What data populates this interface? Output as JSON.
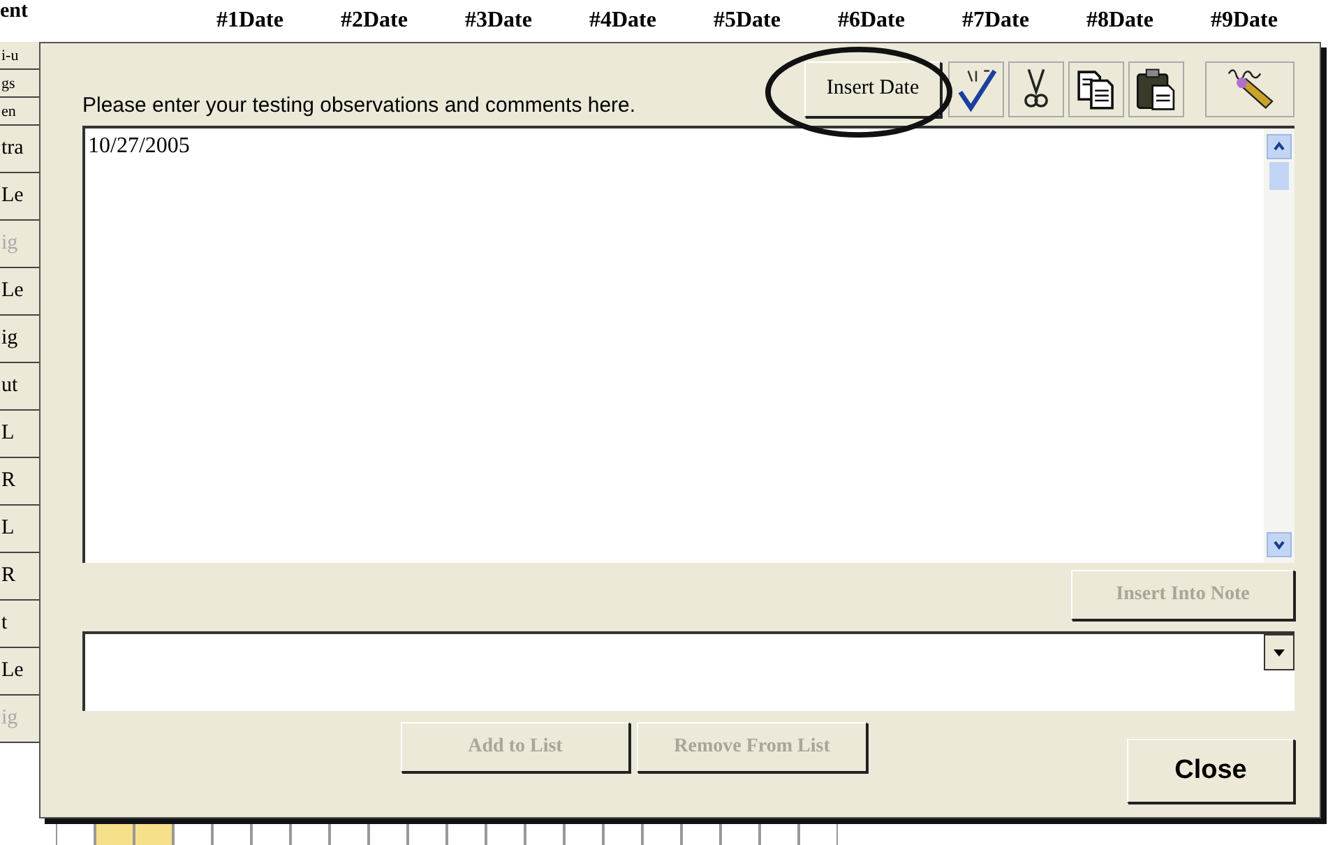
{
  "background": {
    "corner": "ent",
    "date_columns": [
      "#1Date",
      "#2Date",
      "#3Date",
      "#4Date",
      "#5Date",
      "#6Date",
      "#7Date",
      "#8Date",
      "#9Date"
    ],
    "row_labels": [
      {
        "text": "i-u",
        "disabled": false
      },
      {
        "text": "gs",
        "disabled": false
      },
      {
        "text": "en",
        "disabled": false
      },
      {
        "text": "tra",
        "disabled": false
      },
      {
        "text": "Le",
        "disabled": false
      },
      {
        "text": "ig",
        "disabled": true
      },
      {
        "text": "Le",
        "disabled": false
      },
      {
        "text": "ig",
        "disabled": false
      },
      {
        "text": "ut",
        "disabled": false
      },
      {
        "text": "L",
        "disabled": false
      },
      {
        "text": "R",
        "disabled": false
      },
      {
        "text": "L",
        "disabled": false
      },
      {
        "text": "R",
        "disabled": false
      },
      {
        "text": "t",
        "disabled": false
      },
      {
        "text": "Le",
        "disabled": false
      },
      {
        "text": "ig",
        "disabled": true
      }
    ],
    "bottom_cells": [
      {
        "highlighted": false
      },
      {
        "highlighted": true
      },
      {
        "highlighted": true
      },
      {
        "highlighted": false
      },
      {
        "highlighted": false
      },
      {
        "highlighted": false
      },
      {
        "highlighted": false
      },
      {
        "highlighted": false
      },
      {
        "highlighted": false
      },
      {
        "highlighted": false
      },
      {
        "highlighted": false
      },
      {
        "highlighted": false
      },
      {
        "highlighted": false
      },
      {
        "highlighted": false
      },
      {
        "highlighted": false
      },
      {
        "highlighted": false
      },
      {
        "highlighted": false
      },
      {
        "highlighted": false
      },
      {
        "highlighted": false
      },
      {
        "highlighted": false
      }
    ]
  },
  "dialog": {
    "prompt": "Please enter your testing observations and comments here.",
    "toolbar": [
      {
        "kind": "text",
        "label": "Insert Date",
        "circled": true
      },
      {
        "kind": "spellcheck"
      },
      {
        "kind": "cut"
      },
      {
        "kind": "copy"
      },
      {
        "kind": "paste"
      },
      {
        "kind": "sign"
      }
    ],
    "note_text": "10/27/2005",
    "insert_into_note": {
      "label": "Insert Into Note",
      "disabled": true
    },
    "list_buttons": [
      {
        "label": "Add to List",
        "disabled": true
      },
      {
        "label": "Remove From List",
        "disabled": true
      }
    ],
    "close": {
      "label": "Close",
      "disabled": false
    }
  }
}
